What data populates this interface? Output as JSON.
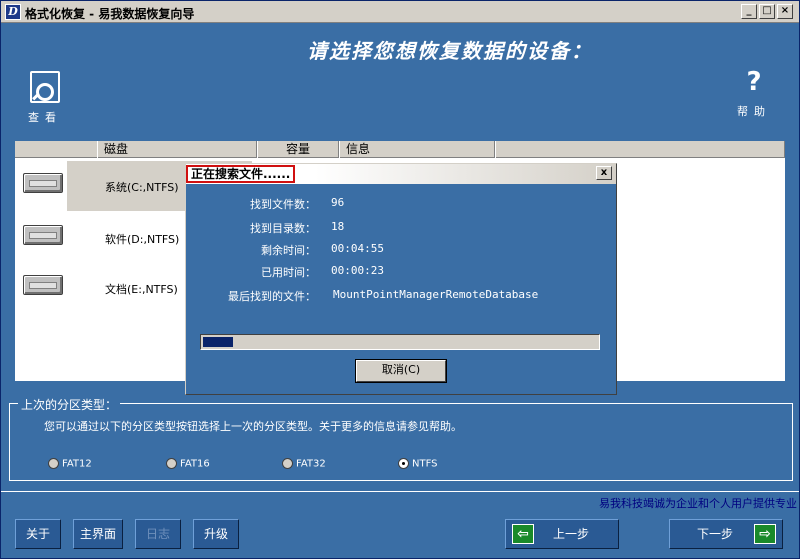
{
  "window": {
    "title": "格式化恢复 - 易我数据恢复向导",
    "icon": "D"
  },
  "header": {
    "heading": "请选择您想恢复数据的设备：",
    "view_label": "查看",
    "help_label": "帮助",
    "help_glyph": "?"
  },
  "disk_list": {
    "columns": [
      "磁盘",
      "容量",
      "信息"
    ],
    "rows": [
      {
        "name": "系统(C:,NTFS)"
      },
      {
        "name": "软件(D:,NTFS)"
      },
      {
        "name": "文档(E:,NTFS)"
      }
    ]
  },
  "partition_group": {
    "legend": "上次的分区类型：",
    "description": "您可以通过以下的分区类型按钮选择上一次的分区类型。关于更多的信息请参见帮助。",
    "options": [
      "FAT12",
      "FAT16",
      "FAT32",
      "NTFS"
    ],
    "selected": "NTFS"
  },
  "slogan": "易我科技竭诚为企业和个人用户提供专业",
  "buttons": {
    "about": "关于",
    "main": "主界面",
    "log": "日志",
    "upgrade": "升级",
    "prev": "上一步",
    "next": "下一步"
  },
  "dialog": {
    "title": "正在搜索文件......",
    "close_glyph": "x",
    "stats": [
      {
        "label": "找到文件数：",
        "value": "96"
      },
      {
        "label": "找到目录数：",
        "value": "18"
      },
      {
        "label": "剩余时间：",
        "value": "00:04:55"
      },
      {
        "label": "已用时间：",
        "value": "00:00:23"
      },
      {
        "label": "最后找到的文件：",
        "value": "MountPointManagerRemoteDatabase"
      }
    ],
    "progress": 0.075,
    "cancel": "取消(C)"
  }
}
